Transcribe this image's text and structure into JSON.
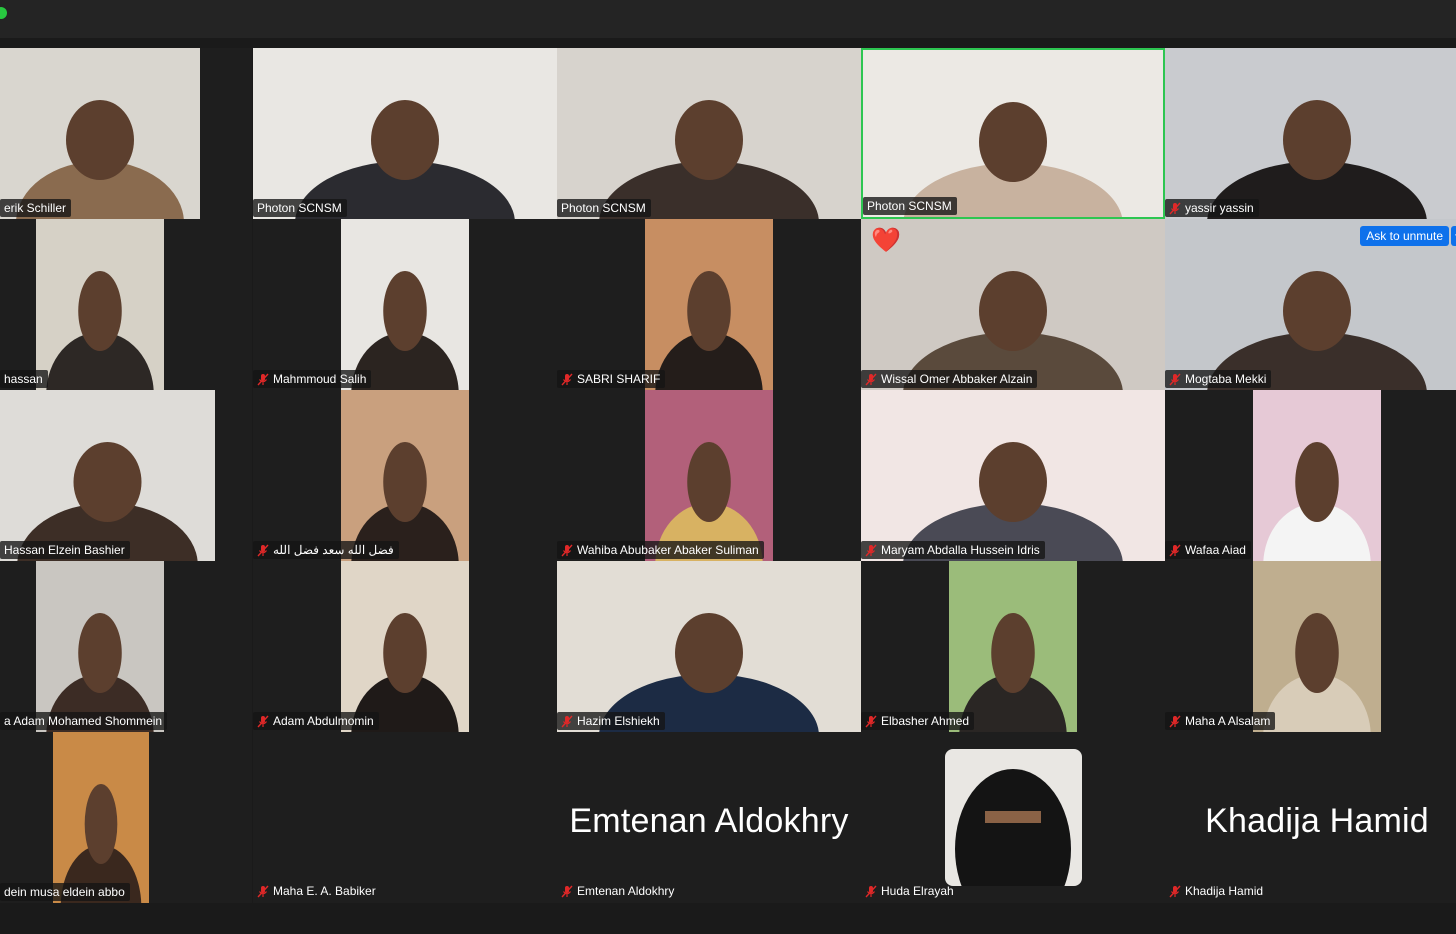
{
  "app": {
    "title": ""
  },
  "colors": {
    "active_speaker_border": "#2dc651",
    "mute_icon": "#e02828",
    "unmute_button": "#0e71eb",
    "heart": "#e0192c"
  },
  "window_controls": {
    "close_dot_color": "#28c840"
  },
  "tiles": [
    {
      "name": "erik Schiller",
      "muted": false,
      "video": true
    },
    {
      "name": "Photon SCNSM",
      "muted": false,
      "video": true
    },
    {
      "name": "Photon SCNSM",
      "muted": false,
      "video": true
    },
    {
      "name": "Photon SCNSM",
      "muted": false,
      "video": true,
      "active": true
    },
    {
      "name": "yassir yassin",
      "muted": true,
      "video": true
    },
    {
      "name": "hassan",
      "muted": false,
      "video": true
    },
    {
      "name": "Mahmmoud Salih",
      "muted": true,
      "video": true
    },
    {
      "name": "SABRI SHARIF",
      "muted": true,
      "video": true
    },
    {
      "name": "Wissal Omer Abbaker Alzain",
      "muted": true,
      "video": true,
      "reaction": "❤️"
    },
    {
      "name": "Mogtaba Mekki",
      "muted": true,
      "video": true,
      "ask_unmute": "Ask to unmute",
      "more": "···"
    },
    {
      "name": "Hassan Elzein Bashier",
      "muted": false,
      "video": true
    },
    {
      "name": "فضل الله سعد فضل الله",
      "muted": true,
      "video": true
    },
    {
      "name": "Wahiba Abubaker Abaker Suliman",
      "muted": true,
      "video": true
    },
    {
      "name": "Maryam Abdalla Hussein Idris",
      "muted": true,
      "video": true
    },
    {
      "name": "Wafaa Aiad",
      "muted": true,
      "video": true
    },
    {
      "name": "a Adam Mohamed Shommein",
      "muted": false,
      "video": true
    },
    {
      "name": "Adam Abdulmomin",
      "muted": true,
      "video": true
    },
    {
      "name": "Hazim Elshiekh",
      "muted": true,
      "video": true
    },
    {
      "name": "Elbasher Ahmed",
      "muted": true,
      "video": true
    },
    {
      "name": "Maha A Alsalam",
      "muted": true,
      "video": true
    },
    {
      "name": "dein musa eldein abbo",
      "muted": false,
      "video": true
    },
    {
      "name": "Maha E. A. Babiker",
      "muted": true,
      "video": false
    },
    {
      "name": "Emtenan Aldokhry",
      "muted": true,
      "video": false,
      "display_name": "Emtenan Aldokhry"
    },
    {
      "name": "Huda Elrayah",
      "muted": true,
      "video": false,
      "avatar": true
    },
    {
      "name": "Khadija Hamid",
      "muted": true,
      "video": false,
      "display_name": "Khadija Hamid"
    }
  ]
}
